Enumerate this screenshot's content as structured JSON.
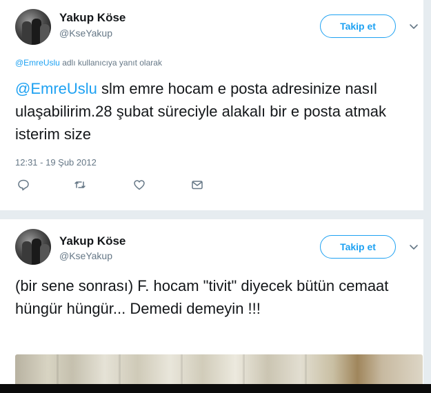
{
  "tweets": [
    {
      "name": "Yakup Köse",
      "handle": "@KseYakup",
      "follow_label": "Takip et",
      "reply_context": {
        "mention": "@EmreUslu",
        "suffix": " adlı kullanıcıya yanıt olarak"
      },
      "text": {
        "mention": "@EmreUslu",
        "body": " slm emre hocam e posta adresinize nasıl ulaşabilirim.28 şubat süreciyle alakalı bir e posta atmak isterim size"
      },
      "timestamp": "12:31 - 19 Şub 2012",
      "actions": [
        "reply-icon",
        "retweet-icon",
        "like-icon",
        "message-icon"
      ]
    },
    {
      "name": "Yakup Köse",
      "handle": "@KseYakup",
      "follow_label": "Takip et",
      "text": {
        "body": "(bir sene sonrası) F. hocam \"tivit\" diyecek bütün cemaat hüngür hüngür... Demedi demeyin !!!"
      }
    }
  ],
  "colors": {
    "accent": "#1da1f2",
    "secondary_text": "#657786",
    "background": "#e6ecf0"
  }
}
